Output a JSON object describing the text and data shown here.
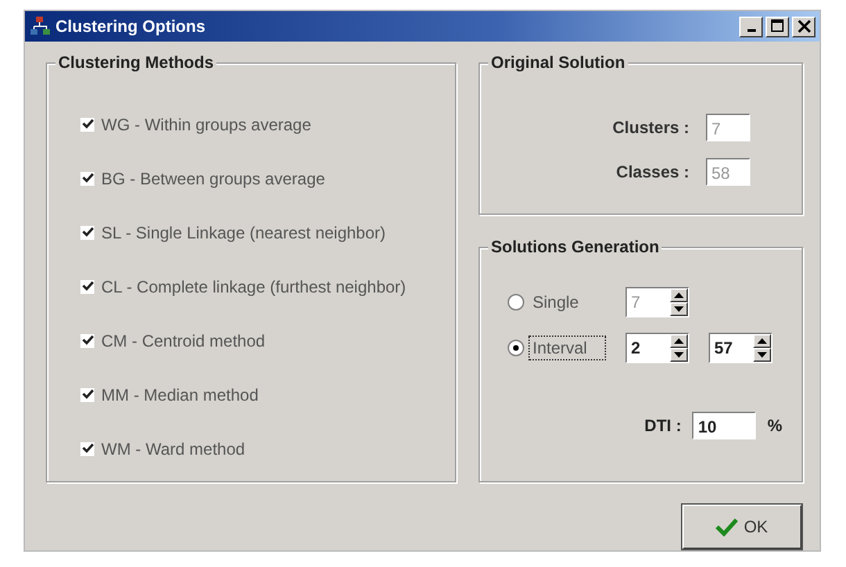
{
  "window": {
    "title": "Clustering Options"
  },
  "clustering_methods": {
    "title": "Clustering Methods",
    "items": [
      {
        "label": "WG - Within groups average",
        "checked": true
      },
      {
        "label": "BG - Between groups average",
        "checked": true
      },
      {
        "label": "SL - Single Linkage (nearest neighbor)",
        "checked": true
      },
      {
        "label": "CL - Complete linkage (furthest neighbor)",
        "checked": true
      },
      {
        "label": "CM - Centroid method",
        "checked": true
      },
      {
        "label": "MM - Median method",
        "checked": true
      },
      {
        "label": "WM - Ward method",
        "checked": true
      }
    ]
  },
  "original_solution": {
    "title": "Original Solution",
    "fields": [
      {
        "label": "Clusters :",
        "value": "7",
        "disabled": true
      },
      {
        "label": "Classes :",
        "value": "58",
        "disabled": true
      }
    ]
  },
  "solutions_generation": {
    "title": "Solutions Generation",
    "options": [
      {
        "label": "Single",
        "selected": false,
        "spinners": [
          {
            "value": "7"
          }
        ]
      },
      {
        "label": "Interval",
        "selected": true,
        "spinners": [
          {
            "value": "2"
          },
          {
            "value": "57"
          }
        ]
      }
    ],
    "dti": {
      "label": "DTI :",
      "value": "10",
      "unit": "%"
    }
  },
  "buttons": [
    {
      "label": "OK"
    }
  ]
}
